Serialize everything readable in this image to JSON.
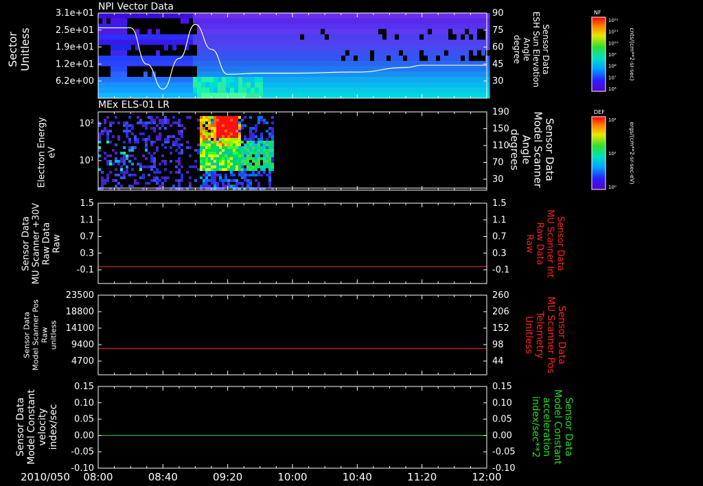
{
  "colors": {
    "background": "#000000",
    "axis": "#ffffff",
    "red_series": "#ff2020",
    "green_series": "#22dd22",
    "white_series": "#ffffff"
  },
  "time_axis": {
    "date_label": "2010/050",
    "start": "08:00",
    "end": "12:00",
    "tick_labels": [
      "08:00",
      "08:40",
      "09:20",
      "10:00",
      "10:40",
      "11:20",
      "12:00"
    ]
  },
  "colorbars": [
    {
      "title": "NF",
      "unit_label": "cnts/(cm**2-sr-sec)",
      "tick_labels": [
        "10¹²",
        "10¹¹",
        "10¹⁰",
        "10⁹",
        "10⁸",
        "10⁷",
        "10⁶"
      ]
    },
    {
      "title": "DEF",
      "unit_label": "ergs/(cm**2-sr-sec-eV)",
      "tick_labels": [
        "10⁴",
        "10²",
        "10⁰"
      ]
    }
  ],
  "chart_data": [
    {
      "type": "heatmap",
      "title": "NPI Vector Data",
      "ylabel": [
        "Sector",
        "Unitless"
      ],
      "y_tick_labels": [
        "3.1e+01",
        "2.5e+01",
        "1.9e+01",
        "1.2e+01",
        "6.2e+00"
      ],
      "colorbar": "NF",
      "overlay_series": {
        "name": "ESH Sun Elevation Angle",
        "right_label": [
          "Sensor Data",
          "ESH Sun Elevation",
          "Angle",
          "degree"
        ],
        "right_ticks": [
          "90",
          "75",
          "60",
          "45",
          "30"
        ],
        "ylim": [
          15,
          90
        ],
        "x": [
          "08:00",
          "08:20",
          "08:30",
          "08:40",
          "08:50",
          "09:00",
          "09:10",
          "09:20",
          "09:40",
          "10:00",
          "10:40",
          "11:10",
          "11:20",
          "12:00"
        ],
        "y": [
          77,
          77,
          45,
          23,
          50,
          80,
          58,
          36,
          37,
          37,
          38,
          42,
          44,
          44
        ]
      }
    },
    {
      "type": "heatmap",
      "title": "MEx ELS-01 LR",
      "ylabel": [
        "Electron Energy",
        "eV"
      ],
      "y_tick_labels": [
        "10²",
        "10¹"
      ],
      "colorbar": "DEF",
      "data_extent": [
        "08:00",
        "09:47"
      ],
      "overlay_series": {
        "name": "Model Scanner Angle",
        "right_label": [
          "Sensor Data",
          "Model Scanner",
          "Angle",
          "degrees"
        ],
        "right_ticks": [
          "190",
          "150",
          "110",
          "70",
          "30"
        ],
        "ylim": [
          0,
          190
        ],
        "x": [
          "08:00",
          "12:00"
        ],
        "y": [
          0,
          0
        ]
      }
    },
    {
      "type": "line",
      "left_label": [
        "Sensor Data",
        "MU Scanner +30V",
        "Raw Data",
        "Raw"
      ],
      "left_ticks": [
        "1.5",
        "1.1",
        "0.7",
        "0.3",
        "-0.1"
      ],
      "right_label": [
        "Sensor Data",
        "MU Scanner Int",
        "Raw Data",
        "Raw"
      ],
      "right_ticks": [
        "1.5",
        "1.1",
        "0.7",
        "0.3",
        "-0.1"
      ],
      "ylim": [
        -0.4,
        1.5
      ],
      "series": [
        {
          "x": [
            "08:00",
            "12:00"
          ],
          "y": [
            0.0,
            0.0
          ],
          "color": "#ff2020"
        }
      ]
    },
    {
      "type": "line",
      "left_label": [
        "Sensor Data",
        "Model Scanner Pos",
        "Raw",
        "unitless"
      ],
      "left_ticks": [
        "23500",
        "18800",
        "14100",
        "9400",
        "4700"
      ],
      "right_label": [
        "Sensor Data",
        "MU Scanner Pos",
        "Telemetry",
        "Unitless"
      ],
      "right_ticks": [
        "260",
        "206",
        "152",
        "98",
        "44"
      ],
      "ylim": [
        0,
        23500
      ],
      "series": [
        {
          "x": [
            "08:00",
            "12:00"
          ],
          "y": [
            7800,
            7800
          ],
          "color": "#ff2020"
        }
      ]
    },
    {
      "type": "line",
      "left_label": [
        "Sensor Data",
        "Model Constant",
        "velocity",
        "index/sec"
      ],
      "left_ticks": [
        "0.15",
        "0.10",
        "0.05",
        "0.00",
        "-0.05",
        "-0.10"
      ],
      "right_label": [
        "Sensor Data",
        "Model Constant",
        "acceleration",
        "index/sec**2"
      ],
      "right_ticks": [
        "0.15",
        "0.10",
        "0.05",
        "0.00",
        "-0.05",
        "-0.10"
      ],
      "ylim": [
        -0.1,
        0.15
      ],
      "series": [
        {
          "x": [
            "08:00",
            "12:00"
          ],
          "y": [
            0.0,
            0.0
          ],
          "color": "#22dd22"
        }
      ]
    }
  ]
}
